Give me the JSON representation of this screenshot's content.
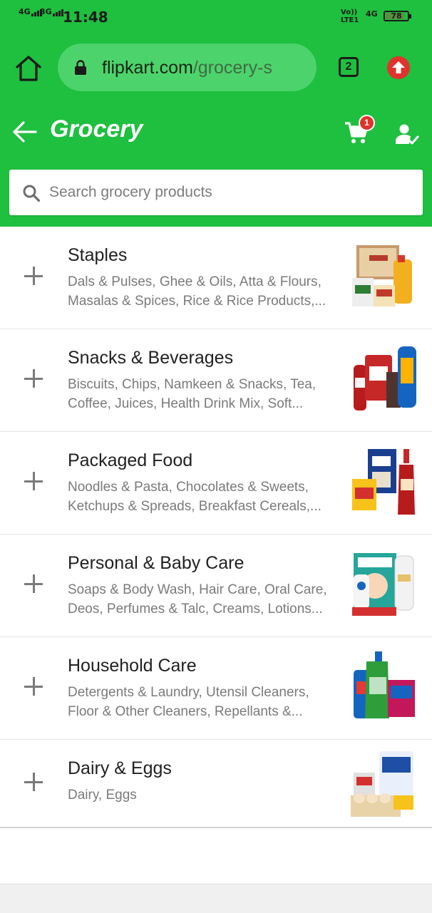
{
  "status_bar": {
    "signal1": "4G",
    "signal2": "3G",
    "time": "11:48",
    "volte_top": "Vo))",
    "volte_bottom": "LTE1",
    "network": "4G",
    "battery": "78"
  },
  "browser": {
    "url_host": "flipkart.com",
    "url_path": "/grocery-s",
    "tab_count": "2"
  },
  "header": {
    "title": "Grocery",
    "cart_badge": "1",
    "search_placeholder": "Search grocery products"
  },
  "categories": [
    {
      "title": "Staples",
      "line1": "Dals & Pulses, Ghee & Oils, Atta & Flours,",
      "line2": "Masalas & Spices, Rice & Rice Products,..."
    },
    {
      "title": "Snacks & Beverages",
      "line1": "Biscuits, Chips, Namkeen & Snacks, Tea,",
      "line2": "Coffee, Juices, Health Drink Mix, Soft..."
    },
    {
      "title": "Packaged Food",
      "line1": "Noodles & Pasta, Chocolates & Sweets,",
      "line2": "Ketchups & Spreads, Breakfast Cereals,..."
    },
    {
      "title": "Personal & Baby Care",
      "line1": "Soaps & Body Wash, Hair Care, Oral Care,",
      "line2": "Deos, Perfumes & Talc, Creams, Lotions..."
    },
    {
      "title": "Household Care",
      "line1": "Detergents & Laundry, Utensil Cleaners,",
      "line2": "Floor & Other Cleaners, Repellants &..."
    },
    {
      "title": "Dairy & Eggs",
      "line1": "Dairy, Eggs",
      "line2": ""
    }
  ],
  "icons": {
    "home": "home-icon",
    "lock": "lock-icon",
    "tabs": "tabs-icon",
    "update": "arrow-up-icon",
    "back": "back-arrow-icon",
    "cart": "cart-icon",
    "account": "account-icon",
    "search": "search-icon",
    "expand": "plus-icon"
  },
  "colors": {
    "brand_green": "#1fbf3f",
    "badge_red": "#e0332b"
  }
}
